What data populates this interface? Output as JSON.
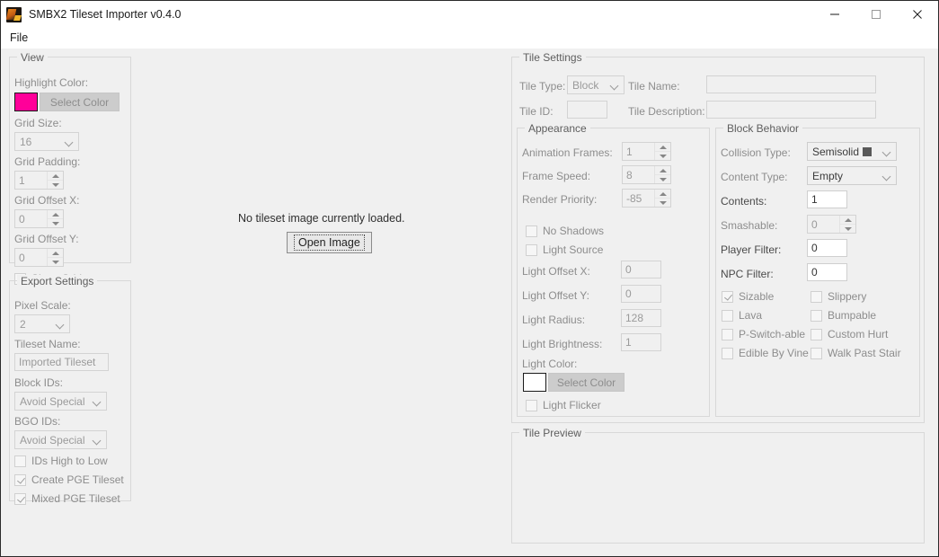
{
  "window": {
    "title": "SMBX2 Tileset Importer v0.4.0",
    "icon": "app-icon",
    "controls": {
      "minimize": "minimize",
      "maximize": "maximize",
      "close": "close"
    }
  },
  "menubar": {
    "items": [
      {
        "label": "File"
      }
    ]
  },
  "view_panel": {
    "legend": "View",
    "highlight_color_label": "Highlight Color:",
    "highlight_color": "#ff0099",
    "select_color_label": "Select Color",
    "grid_size_label": "Grid Size:",
    "grid_size_value": "16",
    "grid_padding_label": "Grid Padding:",
    "grid_padding_value": "1",
    "grid_offset_x_label": "Grid Offset X:",
    "grid_offset_x_value": "0",
    "grid_offset_y_label": "Grid Offset Y:",
    "grid_offset_y_value": "0",
    "show_grid_label": "Show Grid",
    "show_grid_checked": true
  },
  "export_panel": {
    "legend": "Export Settings",
    "pixel_scale_label": "Pixel Scale:",
    "pixel_scale_value": "2",
    "tileset_name_label": "Tileset Name:",
    "tileset_name_value": "Imported Tileset",
    "block_ids_label": "Block IDs:",
    "block_ids_value": "Avoid Special",
    "bgo_ids_label": "BGO IDs:",
    "bgo_ids_value": "Avoid Special",
    "ids_high_to_low_label": "IDs High to Low",
    "ids_high_to_low_checked": false,
    "create_pge_label": "Create PGE Tileset",
    "create_pge_checked": true,
    "mixed_pge_label": "Mixed PGE Tileset",
    "mixed_pge_checked": true
  },
  "canvas": {
    "empty_message": "No tileset image currently loaded.",
    "open_image_label": "Open Image"
  },
  "tile_settings": {
    "legend": "Tile Settings",
    "tile_type_label": "Tile Type:",
    "tile_type_value": "Block",
    "tile_name_label": "Tile Name:",
    "tile_name_value": "",
    "tile_id_label": "Tile ID:",
    "tile_id_value": "",
    "tile_description_label": "Tile Description:",
    "tile_description_value": ""
  },
  "appearance": {
    "legend": "Appearance",
    "animation_frames_label": "Animation Frames:",
    "animation_frames_value": "1",
    "frame_speed_label": "Frame Speed:",
    "frame_speed_value": "8",
    "render_priority_label": "Render Priority:",
    "render_priority_value": "-85",
    "no_shadows_label": "No Shadows",
    "no_shadows_checked": false,
    "light_source_label": "Light Source",
    "light_source_checked": false,
    "light_offset_x_label": "Light Offset X:",
    "light_offset_x_value": "0",
    "light_offset_y_label": "Light Offset Y:",
    "light_offset_y_value": "0",
    "light_radius_label": "Light Radius:",
    "light_radius_value": "128",
    "light_brightness_label": "Light Brightness:",
    "light_brightness_value": "1",
    "light_color_label": "Light Color:",
    "light_color": "#ffffff",
    "light_select_color_label": "Select Color",
    "light_flicker_label": "Light Flicker",
    "light_flicker_checked": false
  },
  "block_behavior": {
    "legend": "Block Behavior",
    "collision_type_label": "Collision Type:",
    "collision_type_value": "Semisolid",
    "collision_type_swatch": "#585858",
    "content_type_label": "Content Type:",
    "content_type_value": "Empty",
    "contents_label": "Contents:",
    "contents_value": "1",
    "smashable_label": "Smashable:",
    "smashable_value": "0",
    "player_filter_label": "Player Filter:",
    "player_filter_value": "0",
    "npc_filter_label": "NPC Filter:",
    "npc_filter_value": "0",
    "flags": [
      {
        "label": "Sizable",
        "checked": true
      },
      {
        "label": "Slippery",
        "checked": false
      },
      {
        "label": "Lava",
        "checked": false
      },
      {
        "label": "Bumpable",
        "checked": false
      },
      {
        "label": "P-Switch-able",
        "checked": false
      },
      {
        "label": "Custom Hurt",
        "checked": false
      },
      {
        "label": "Edible By Vine",
        "checked": false
      },
      {
        "label": "Walk Past Stair",
        "checked": false
      }
    ]
  },
  "tile_preview": {
    "legend": "Tile Preview"
  }
}
